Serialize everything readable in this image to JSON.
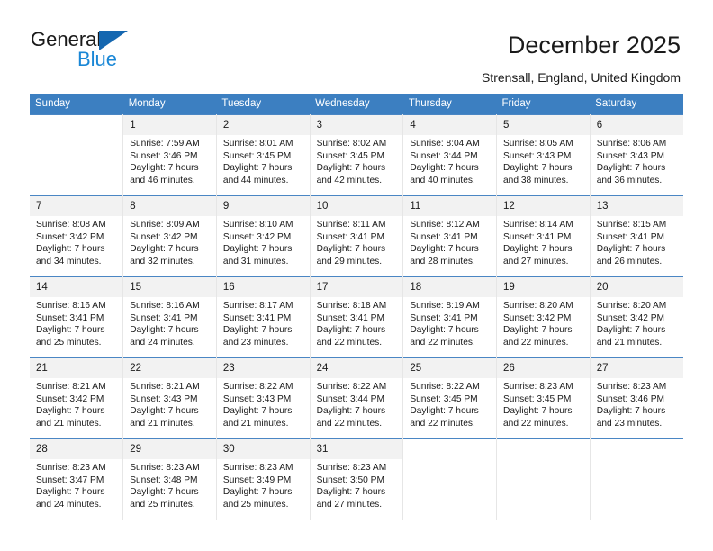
{
  "brand": {
    "name_part1": "General",
    "name_part2": "Blue",
    "logo_icon": "blue-triangle-icon"
  },
  "header": {
    "title": "December 2025",
    "subtitle": "Strensall, England, United Kingdom"
  },
  "colors": {
    "header_blue": "#3c7fc1",
    "row_divider_blue": "#4a86c4",
    "daynum_band": "#f2f2f2",
    "brand_blue": "#1a87d6",
    "triangle_blue": "#1567b0"
  },
  "weekdays": [
    "Sunday",
    "Monday",
    "Tuesday",
    "Wednesday",
    "Thursday",
    "Friday",
    "Saturday"
  ],
  "labels": {
    "sunrise_prefix": "Sunrise:",
    "sunset_prefix": "Sunset:",
    "daylight_prefix": "Daylight:"
  },
  "weeks": [
    [
      {
        "empty": true
      },
      {
        "day": "1",
        "sunrise": "Sunrise: 7:59 AM",
        "sunset": "Sunset: 3:46 PM",
        "daylight1": "Daylight: 7 hours",
        "daylight2": "and 46 minutes."
      },
      {
        "day": "2",
        "sunrise": "Sunrise: 8:01 AM",
        "sunset": "Sunset: 3:45 PM",
        "daylight1": "Daylight: 7 hours",
        "daylight2": "and 44 minutes."
      },
      {
        "day": "3",
        "sunrise": "Sunrise: 8:02 AM",
        "sunset": "Sunset: 3:45 PM",
        "daylight1": "Daylight: 7 hours",
        "daylight2": "and 42 minutes."
      },
      {
        "day": "4",
        "sunrise": "Sunrise: 8:04 AM",
        "sunset": "Sunset: 3:44 PM",
        "daylight1": "Daylight: 7 hours",
        "daylight2": "and 40 minutes."
      },
      {
        "day": "5",
        "sunrise": "Sunrise: 8:05 AM",
        "sunset": "Sunset: 3:43 PM",
        "daylight1": "Daylight: 7 hours",
        "daylight2": "and 38 minutes."
      },
      {
        "day": "6",
        "sunrise": "Sunrise: 8:06 AM",
        "sunset": "Sunset: 3:43 PM",
        "daylight1": "Daylight: 7 hours",
        "daylight2": "and 36 minutes."
      }
    ],
    [
      {
        "day": "7",
        "sunrise": "Sunrise: 8:08 AM",
        "sunset": "Sunset: 3:42 PM",
        "daylight1": "Daylight: 7 hours",
        "daylight2": "and 34 minutes."
      },
      {
        "day": "8",
        "sunrise": "Sunrise: 8:09 AM",
        "sunset": "Sunset: 3:42 PM",
        "daylight1": "Daylight: 7 hours",
        "daylight2": "and 32 minutes."
      },
      {
        "day": "9",
        "sunrise": "Sunrise: 8:10 AM",
        "sunset": "Sunset: 3:42 PM",
        "daylight1": "Daylight: 7 hours",
        "daylight2": "and 31 minutes."
      },
      {
        "day": "10",
        "sunrise": "Sunrise: 8:11 AM",
        "sunset": "Sunset: 3:41 PM",
        "daylight1": "Daylight: 7 hours",
        "daylight2": "and 29 minutes."
      },
      {
        "day": "11",
        "sunrise": "Sunrise: 8:12 AM",
        "sunset": "Sunset: 3:41 PM",
        "daylight1": "Daylight: 7 hours",
        "daylight2": "and 28 minutes."
      },
      {
        "day": "12",
        "sunrise": "Sunrise: 8:14 AM",
        "sunset": "Sunset: 3:41 PM",
        "daylight1": "Daylight: 7 hours",
        "daylight2": "and 27 minutes."
      },
      {
        "day": "13",
        "sunrise": "Sunrise: 8:15 AM",
        "sunset": "Sunset: 3:41 PM",
        "daylight1": "Daylight: 7 hours",
        "daylight2": "and 26 minutes."
      }
    ],
    [
      {
        "day": "14",
        "sunrise": "Sunrise: 8:16 AM",
        "sunset": "Sunset: 3:41 PM",
        "daylight1": "Daylight: 7 hours",
        "daylight2": "and 25 minutes."
      },
      {
        "day": "15",
        "sunrise": "Sunrise: 8:16 AM",
        "sunset": "Sunset: 3:41 PM",
        "daylight1": "Daylight: 7 hours",
        "daylight2": "and 24 minutes."
      },
      {
        "day": "16",
        "sunrise": "Sunrise: 8:17 AM",
        "sunset": "Sunset: 3:41 PM",
        "daylight1": "Daylight: 7 hours",
        "daylight2": "and 23 minutes."
      },
      {
        "day": "17",
        "sunrise": "Sunrise: 8:18 AM",
        "sunset": "Sunset: 3:41 PM",
        "daylight1": "Daylight: 7 hours",
        "daylight2": "and 22 minutes."
      },
      {
        "day": "18",
        "sunrise": "Sunrise: 8:19 AM",
        "sunset": "Sunset: 3:41 PM",
        "daylight1": "Daylight: 7 hours",
        "daylight2": "and 22 minutes."
      },
      {
        "day": "19",
        "sunrise": "Sunrise: 8:20 AM",
        "sunset": "Sunset: 3:42 PM",
        "daylight1": "Daylight: 7 hours",
        "daylight2": "and 22 minutes."
      },
      {
        "day": "20",
        "sunrise": "Sunrise: 8:20 AM",
        "sunset": "Sunset: 3:42 PM",
        "daylight1": "Daylight: 7 hours",
        "daylight2": "and 21 minutes."
      }
    ],
    [
      {
        "day": "21",
        "sunrise": "Sunrise: 8:21 AM",
        "sunset": "Sunset: 3:42 PM",
        "daylight1": "Daylight: 7 hours",
        "daylight2": "and 21 minutes."
      },
      {
        "day": "22",
        "sunrise": "Sunrise: 8:21 AM",
        "sunset": "Sunset: 3:43 PM",
        "daylight1": "Daylight: 7 hours",
        "daylight2": "and 21 minutes."
      },
      {
        "day": "23",
        "sunrise": "Sunrise: 8:22 AM",
        "sunset": "Sunset: 3:43 PM",
        "daylight1": "Daylight: 7 hours",
        "daylight2": "and 21 minutes."
      },
      {
        "day": "24",
        "sunrise": "Sunrise: 8:22 AM",
        "sunset": "Sunset: 3:44 PM",
        "daylight1": "Daylight: 7 hours",
        "daylight2": "and 22 minutes."
      },
      {
        "day": "25",
        "sunrise": "Sunrise: 8:22 AM",
        "sunset": "Sunset: 3:45 PM",
        "daylight1": "Daylight: 7 hours",
        "daylight2": "and 22 minutes."
      },
      {
        "day": "26",
        "sunrise": "Sunrise: 8:23 AM",
        "sunset": "Sunset: 3:45 PM",
        "daylight1": "Daylight: 7 hours",
        "daylight2": "and 22 minutes."
      },
      {
        "day": "27",
        "sunrise": "Sunrise: 8:23 AM",
        "sunset": "Sunset: 3:46 PM",
        "daylight1": "Daylight: 7 hours",
        "daylight2": "and 23 minutes."
      }
    ],
    [
      {
        "day": "28",
        "sunrise": "Sunrise: 8:23 AM",
        "sunset": "Sunset: 3:47 PM",
        "daylight1": "Daylight: 7 hours",
        "daylight2": "and 24 minutes."
      },
      {
        "day": "29",
        "sunrise": "Sunrise: 8:23 AM",
        "sunset": "Sunset: 3:48 PM",
        "daylight1": "Daylight: 7 hours",
        "daylight2": "and 25 minutes."
      },
      {
        "day": "30",
        "sunrise": "Sunrise: 8:23 AM",
        "sunset": "Sunset: 3:49 PM",
        "daylight1": "Daylight: 7 hours",
        "daylight2": "and 25 minutes."
      },
      {
        "day": "31",
        "sunrise": "Sunrise: 8:23 AM",
        "sunset": "Sunset: 3:50 PM",
        "daylight1": "Daylight: 7 hours",
        "daylight2": "and 27 minutes."
      },
      {
        "empty": true
      },
      {
        "empty": true
      },
      {
        "empty": true
      }
    ]
  ]
}
